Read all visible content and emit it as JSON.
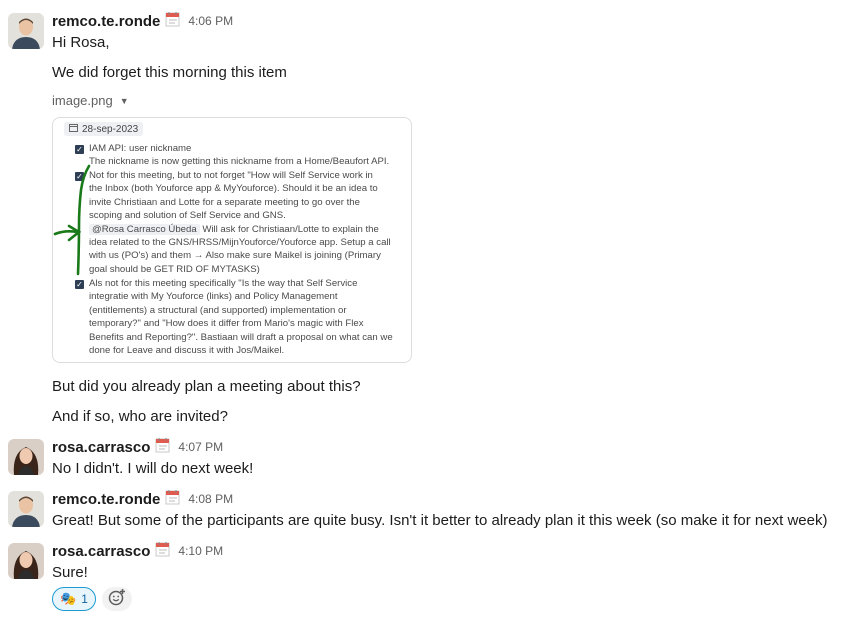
{
  "messages": [
    {
      "user": "remco.te.ronde",
      "time": "4:06 PM",
      "lines": [
        "Hi Rosa,",
        "We did forget this morning this item"
      ],
      "attachment": {
        "filename": "image.png",
        "date": "28-sep-2023",
        "items": [
          {
            "lines": [
              "IAM API: user nickname",
              "The nickname is now getting this nickname from a Home/Beaufort API."
            ]
          },
          {
            "lines": [
              "Not for this meeting, but to not forget \"How will Self Service work in",
              "the Inbox (both Youforce app & MyYouforce). Should it be an idea to",
              "invite Christiaan and Lotte for a separate meeting to go over the",
              "scoping and solution of Self Service and GNS."
            ],
            "mention": "@Rosa Carrasco Úbeda",
            "after_mention": " Will ask for Christiaan/Lotte to explain the",
            "more_lines": [
              "idea related to the GNS/HRSS/MijnYouforce/Youforce app. Setup a call",
              "with us (PO's) and them → Also make sure Maikel is joining (Primary",
              "goal should be GET RID OF MYTASKS)"
            ]
          },
          {
            "lines": [
              "Als not for this meeting specifically \"Is the way that Self Service",
              "integratie with My Youforce (links) and Policy Management",
              "(entitlements) a structural (and supported) implementation or",
              "temporary?\" and \"How does it differ from Mario's magic with Flex",
              "Benefits and Reporting?\". Bastiaan will draft a proposal on what can we",
              "done for Leave and discuss it with Jos/Maikel."
            ]
          }
        ]
      },
      "after_lines": [
        "But did you already plan a meeting about this?",
        "And if so, who are invited?"
      ]
    },
    {
      "user": "rosa.carrasco",
      "time": "4:07 PM",
      "lines": [
        "No I didn't. I will do next week!"
      ]
    },
    {
      "user": "remco.te.ronde",
      "time": "4:08 PM",
      "lines": [
        "Great! But some of the participants are quite busy. Isn't it better to already plan it this week (so make it for next week)"
      ]
    },
    {
      "user": "rosa.carrasco",
      "time": "4:10 PM",
      "lines": [
        "Sure!"
      ]
    }
  ],
  "reaction": {
    "emoji": "🎭",
    "count": "1"
  },
  "icons": {
    "status": "calendar-icon",
    "add_reaction": "add-emoji-icon"
  },
  "colors": {
    "link": "#1264a3",
    "reaction_border": "#1d9bd1",
    "annotation": "#1a7a1a"
  }
}
